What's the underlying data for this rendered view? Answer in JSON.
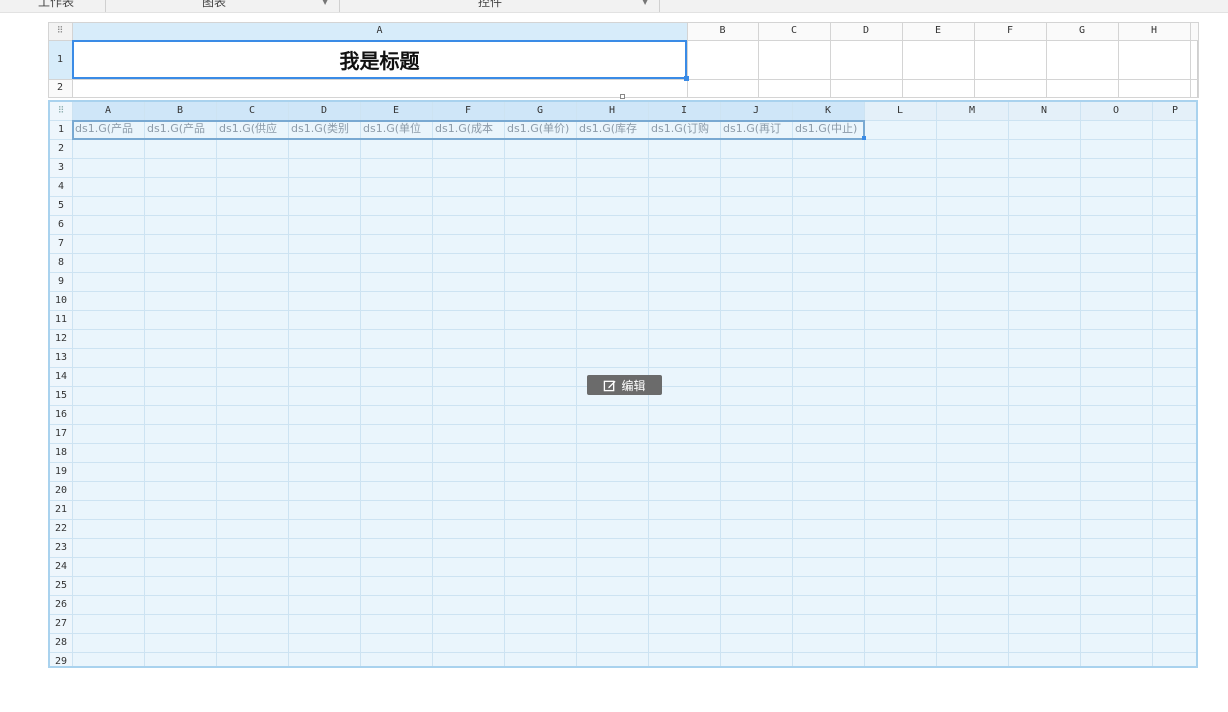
{
  "toolbar": {
    "tab1": "工作表",
    "tab2": "图表",
    "tab3": "控件"
  },
  "outer_sheet": {
    "corner_icon": "grid-dots-icon",
    "columns": [
      "A",
      "B",
      "C",
      "D",
      "E",
      "F",
      "G",
      "H"
    ],
    "rows": [
      "1",
      "2"
    ],
    "title_text": "我是标题"
  },
  "inner_sheet": {
    "corner_icon": "grid-dots-icon",
    "columns": [
      "A",
      "B",
      "C",
      "D",
      "E",
      "F",
      "G",
      "H",
      "I",
      "J",
      "K",
      "L",
      "M",
      "N",
      "O",
      "P"
    ],
    "rows": [
      "1",
      "2",
      "3",
      "4",
      "5",
      "6",
      "7",
      "8",
      "9",
      "10",
      "11",
      "12",
      "13",
      "14",
      "15",
      "16",
      "17",
      "18",
      "19",
      "20",
      "21",
      "22",
      "23",
      "24",
      "25",
      "26",
      "27",
      "28",
      "29"
    ],
    "row1_cells": [
      "ds1.G(产品",
      "ds1.G(产品",
      "ds1.G(供应",
      "ds1.G(类别",
      "ds1.G(单位",
      "ds1.G(成本",
      "ds1.G(单价)",
      "ds1.G(库存",
      "ds1.G(订购",
      "ds1.G(再订",
      "ds1.G(中止)"
    ]
  },
  "edit_button": {
    "label": "编辑",
    "icon": "edit-icon"
  },
  "colors": {
    "selection_border": "#3a8be6",
    "inner_bg": "#eaf5fc",
    "formula_text": "#8b9aa8"
  }
}
